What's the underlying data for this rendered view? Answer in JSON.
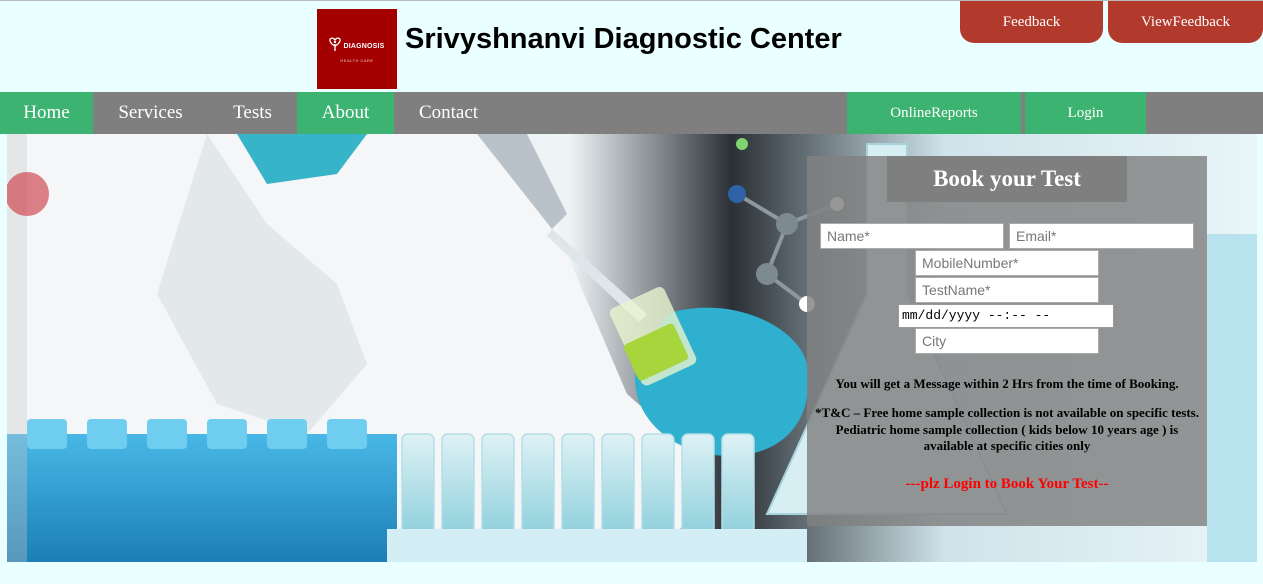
{
  "header": {
    "logo": {
      "text": "DIAGNOSIS",
      "subtext": "HEALTH CARE"
    },
    "title": "Srivyshnanvi Diagnostic Center",
    "feedback_label": "Feedback",
    "view_feedback_label": "ViewFeedback"
  },
  "nav": {
    "items": [
      {
        "label": "Home"
      },
      {
        "label": "Services"
      },
      {
        "label": "Tests"
      },
      {
        "label": "About"
      },
      {
        "label": "Contact"
      }
    ],
    "online_reports_label": "OnlineReports",
    "login_label": "Login"
  },
  "booking": {
    "title": "Book your Test",
    "name_placeholder": "Name*",
    "email_placeholder": "Email*",
    "mobile_placeholder": "MobileNumber*",
    "testname_placeholder": "TestName*",
    "datetime_value": "mm/dd/yyyy --:-- --",
    "city_placeholder": "City",
    "message_note": "You will get a Message within 2 Hrs from the time of Booking.",
    "tc_line1": "*T&C – Free home sample collection is not available on specific tests.",
    "tc_line2": "Pediatric home sample collection ( kids below 10 years age ) is",
    "tc_line3": "available at specific cities only",
    "login_prompt": "---plz Login to Book Your Test--"
  },
  "colors": {
    "page_bg": "#eaffff",
    "accent_red": "#b13a2d",
    "logo_red": "#a40000",
    "nav_gray": "#7f7f7f",
    "nav_green": "#3cb371",
    "prompt_red": "#ff0000"
  }
}
